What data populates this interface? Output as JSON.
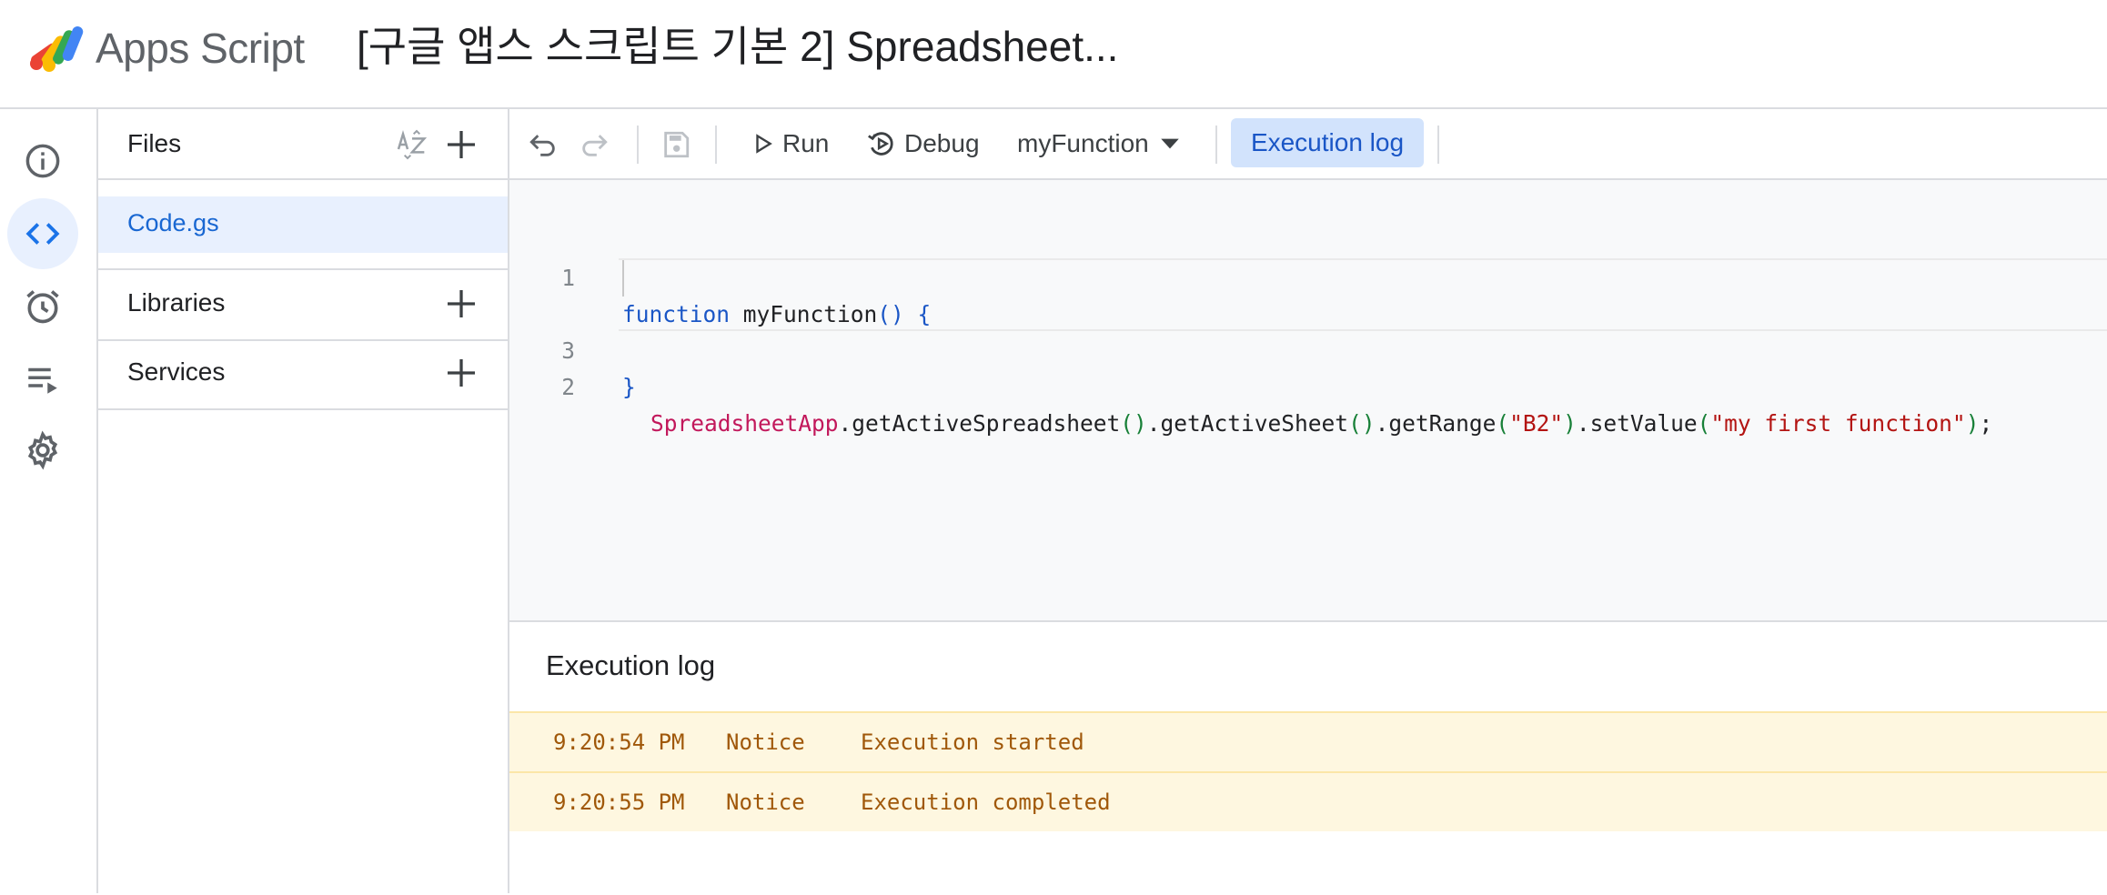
{
  "header": {
    "app_name": "Apps Script",
    "project_title": "[구글 앱스 스크립트 기본 2] Spreadsheet..."
  },
  "rail": {
    "items": [
      {
        "name": "overview",
        "icon": "info-icon"
      },
      {
        "name": "editor",
        "icon": "code-icon",
        "active": true
      },
      {
        "name": "triggers",
        "icon": "alarm-clock-icon"
      },
      {
        "name": "executions",
        "icon": "executions-list-icon"
      },
      {
        "name": "settings",
        "icon": "gear-icon"
      }
    ]
  },
  "files_panel": {
    "files_label": "Files",
    "files": [
      "Code.gs"
    ],
    "libraries_label": "Libraries",
    "services_label": "Services"
  },
  "toolbar": {
    "run_label": "Run",
    "debug_label": "Debug",
    "function_select": "myFunction",
    "exec_log_label": "Execution log"
  },
  "editor": {
    "line_numbers": [
      "1",
      "2",
      "3"
    ],
    "line1": {
      "kw": "function",
      "name": " myFunction",
      "paren": "()",
      "brace": " {"
    },
    "line2": {
      "cls": "SpreadsheetApp",
      "m1": ".getActiveSpreadsheet",
      "p1": "()",
      "m2": ".getActiveSheet",
      "p2": "()",
      "m3": ".getRange",
      "po3": "(",
      "s3": "\"B2\"",
      "pc3": ")",
      "m4": ".setValue",
      "po4": "(",
      "s4": "\"my first function\"",
      "pc4": ")",
      "end": ";"
    },
    "line3": {
      "brace": "}"
    }
  },
  "log": {
    "title": "Execution log",
    "entries": [
      {
        "time": "9:20:54 PM",
        "level": "Notice",
        "message": "Execution started"
      },
      {
        "time": "9:20:55 PM",
        "level": "Notice",
        "message": "Execution completed"
      }
    ]
  },
  "colors": {
    "accent": "#1a73e8",
    "selected_bg": "#e8f0fe",
    "log_bg": "#fef7e0",
    "log_text": "#a0580a"
  }
}
